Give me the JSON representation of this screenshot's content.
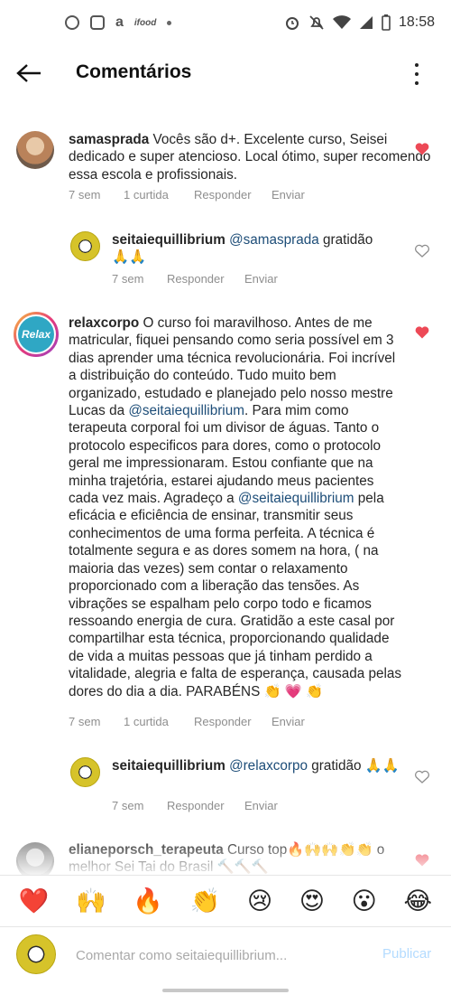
{
  "status_bar": {
    "time": "18:58",
    "app_icons": [
      "instagram-icon",
      "phone-app-icon",
      "amazon-icon",
      "ifood-icon"
    ],
    "app_small_label": "ifood",
    "system_icons": [
      "alarm-icon",
      "mute-icon",
      "wifi-icon",
      "signal-icon",
      "battery-icon"
    ]
  },
  "header": {
    "title": "Comentários"
  },
  "comments": [
    {
      "username": "samasprada",
      "text": "Vocês são d+. Excelente curso, Seisei dedicado e super atencioso. Local ótimo, super recomendo essa escola e profissionais.",
      "time": "7 sem",
      "likes": "1 curtida",
      "reply": "Responder",
      "send": "Enviar",
      "liked": true
    },
    {
      "username": "seitaiequillibrium",
      "mention": "@samasprada",
      "text": "gratidão 🙏🙏",
      "time": "7 sem",
      "reply": "Responder",
      "send": "Enviar",
      "liked": false
    },
    {
      "username": "relaxcorpo",
      "avatar_label": "Relax",
      "text_part1": "O curso foi maravilhoso. Antes de me matricular, fiquei pensando como seria possível em 3 dias aprender uma técnica revolucionária. Foi incrível a distribuição do conteúdo. Tudo muito bem organizado, estudado e planejado pelo nosso mestre Lucas da",
      "mention1": "@seitaiequillibrium",
      "text_part2": ". Para mim como terapeuta corporal foi um divisor de águas. Tanto o protocolo especificos para dores,  como o protocolo geral me impressionaram. Estou confiante que na minha trajetória, estarei ajudando meus pacientes cada vez mais. Agradeço a",
      "mention2": "@seitaiequillibrium",
      "text_part3": "pela eficácia e eficiência de ensinar, transmitir seus conhecimentos de uma forma perfeita. A técnica é totalmente segura e as dores somem na hora, ( na maioria das vezes) sem contar o relaxamento proporcionado com a liberação das tensões. As vibrações se espalham pelo corpo todo e ficamos ressoando energia de cura. Gratidão a este casal por compartilhar esta técnica,  proporcionando  qualidade de vida a muitas pessoas que já tinham perdido a vitalidade, alegria e falta de esperança,  causada pelas dores do dia a dia. PARABÉNS 👏 💗 👏",
      "time": "7 sem",
      "likes": "1 curtida",
      "reply": "Responder",
      "send": "Enviar",
      "liked": true
    },
    {
      "username": "seitaiequillibrium",
      "mention": "@relaxcorpo",
      "text": "gratidão 🙏🙏",
      "time": "7 sem",
      "reply": "Responder",
      "send": "Enviar",
      "liked": false
    },
    {
      "username": "elianeporsch_terapeuta",
      "text": "Curso top🔥🙌🙌👏👏 o melhor Sei Tai do Brasil 🔨🔨🔨",
      "liked": true
    }
  ],
  "emoji_bar": [
    "❤️",
    "🙌",
    "🔥",
    "👏",
    "😢",
    "😍",
    "😮",
    "😂"
  ],
  "composer": {
    "placeholder": "Comentar como seitaiequillibrium...",
    "publish_label": "Publicar"
  },
  "colors": {
    "heart_liked": "#ed4956",
    "mention": "#1d4d78",
    "muted_text": "#8e8e8e",
    "publish_disabled": "#b3dbff"
  }
}
